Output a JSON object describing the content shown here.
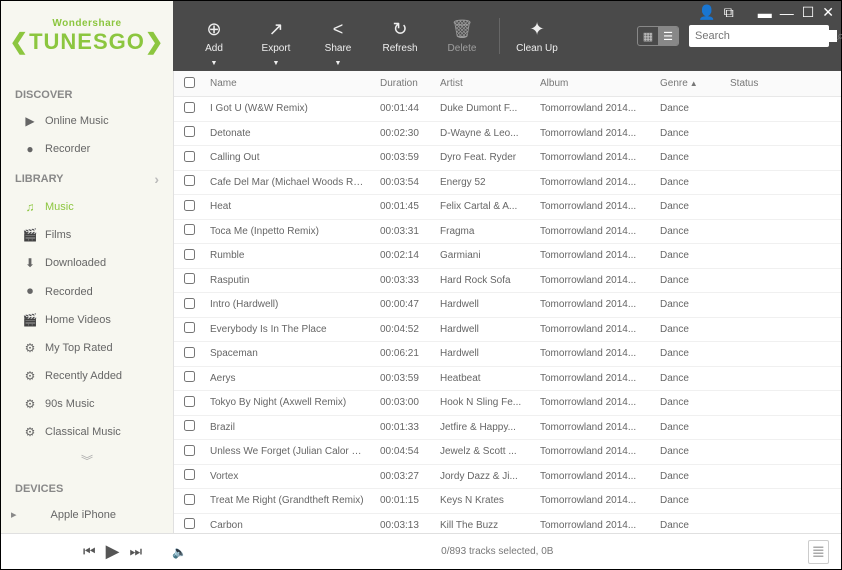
{
  "brand": {
    "company": "Wondershare",
    "product_left": "❮TUNES",
    "product_right": "GO❯"
  },
  "toolbar": {
    "add": "Add",
    "export": "Export",
    "share": "Share",
    "refresh": "Refresh",
    "delete": "Delete",
    "cleanup": "Clean Up",
    "search_placeholder": "Search"
  },
  "sidebar": {
    "discover": "DISCOVER",
    "discover_items": [
      {
        "icon": "▶",
        "label": "Online Music"
      },
      {
        "icon": "●",
        "label": "Recorder"
      }
    ],
    "library": "LIBRARY",
    "library_items": [
      {
        "icon": "♫",
        "label": "Music",
        "active": true
      },
      {
        "icon": "🎬",
        "label": "Films"
      },
      {
        "icon": "⬇",
        "label": "Downloaded"
      },
      {
        "icon": "⏺",
        "label": "Recorded"
      },
      {
        "icon": "🎬",
        "label": "Home Videos"
      },
      {
        "icon": "⚙",
        "label": "My Top Rated"
      },
      {
        "icon": "⚙",
        "label": "Recently Added"
      },
      {
        "icon": "⚙",
        "label": "90s Music"
      },
      {
        "icon": "⚙",
        "label": "Classical Music"
      }
    ],
    "devices": "DEVICES",
    "device_items": [
      {
        "icon": "",
        "label": "Apple iPhone"
      }
    ]
  },
  "columns": {
    "name": "Name",
    "duration": "Duration",
    "artist": "Artist",
    "album": "Album",
    "genre": "Genre",
    "status": "Status"
  },
  "tracks": [
    {
      "name": "I Got U (W&W Remix)",
      "duration": "00:01:44",
      "artist": "Duke Dumont F...",
      "album": "Tomorrowland 2014...",
      "genre": "Dance"
    },
    {
      "name": "Detonate",
      "duration": "00:02:30",
      "artist": "D-Wayne & Leo...",
      "album": "Tomorrowland 2014...",
      "genre": "Dance"
    },
    {
      "name": "Calling Out",
      "duration": "00:03:59",
      "artist": "Dyro Feat. Ryder",
      "album": "Tomorrowland 2014...",
      "genre": "Dance"
    },
    {
      "name": "Cafe Del Mar (Michael Woods Remix)",
      "duration": "00:03:54",
      "artist": "Energy 52",
      "album": "Tomorrowland 2014...",
      "genre": "Dance"
    },
    {
      "name": "Heat",
      "duration": "00:01:45",
      "artist": "Felix Cartal & A...",
      "album": "Tomorrowland 2014...",
      "genre": "Dance"
    },
    {
      "name": "Toca Me (Inpetto Remix)",
      "duration": "00:03:31",
      "artist": "Fragma",
      "album": "Tomorrowland 2014...",
      "genre": "Dance"
    },
    {
      "name": "Rumble",
      "duration": "00:02:14",
      "artist": "Garmiani",
      "album": "Tomorrowland 2014...",
      "genre": "Dance"
    },
    {
      "name": "Rasputin",
      "duration": "00:03:33",
      "artist": "Hard Rock Sofa",
      "album": "Tomorrowland 2014...",
      "genre": "Dance"
    },
    {
      "name": "Intro (Hardwell)",
      "duration": "00:00:47",
      "artist": "Hardwell",
      "album": "Tomorrowland 2014...",
      "genre": "Dance"
    },
    {
      "name": "Everybody Is In The Place",
      "duration": "00:04:52",
      "artist": "Hardwell",
      "album": "Tomorrowland 2014...",
      "genre": "Dance"
    },
    {
      "name": "Spaceman",
      "duration": "00:06:21",
      "artist": "Hardwell",
      "album": "Tomorrowland 2014...",
      "genre": "Dance"
    },
    {
      "name": "Aerys",
      "duration": "00:03:59",
      "artist": "Heatbeat",
      "album": "Tomorrowland 2014...",
      "genre": "Dance"
    },
    {
      "name": "Tokyo By Night (Axwell Remix)",
      "duration": "00:03:00",
      "artist": "Hook N Sling Fe...",
      "album": "Tomorrowland 2014...",
      "genre": "Dance"
    },
    {
      "name": "Brazil",
      "duration": "00:01:33",
      "artist": "Jetfire & Happy...",
      "album": "Tomorrowland 2014...",
      "genre": "Dance"
    },
    {
      "name": "Unless We Forget (Julian Calor Remix)",
      "duration": "00:04:54",
      "artist": "Jewelz & Scott ...",
      "album": "Tomorrowland 2014...",
      "genre": "Dance"
    },
    {
      "name": "Vortex",
      "duration": "00:03:27",
      "artist": "Jordy Dazz & Ji...",
      "album": "Tomorrowland 2014...",
      "genre": "Dance"
    },
    {
      "name": "Treat Me Right (Grandtheft Remix)",
      "duration": "00:01:15",
      "artist": "Keys N Krates",
      "album": "Tomorrowland 2014...",
      "genre": "Dance"
    },
    {
      "name": "Carbon",
      "duration": "00:03:13",
      "artist": "Kill The Buzz",
      "album": "Tomorrowland 2014...",
      "genre": "Dance"
    }
  ],
  "footer": {
    "status": "0/893 tracks selected, 0B"
  }
}
